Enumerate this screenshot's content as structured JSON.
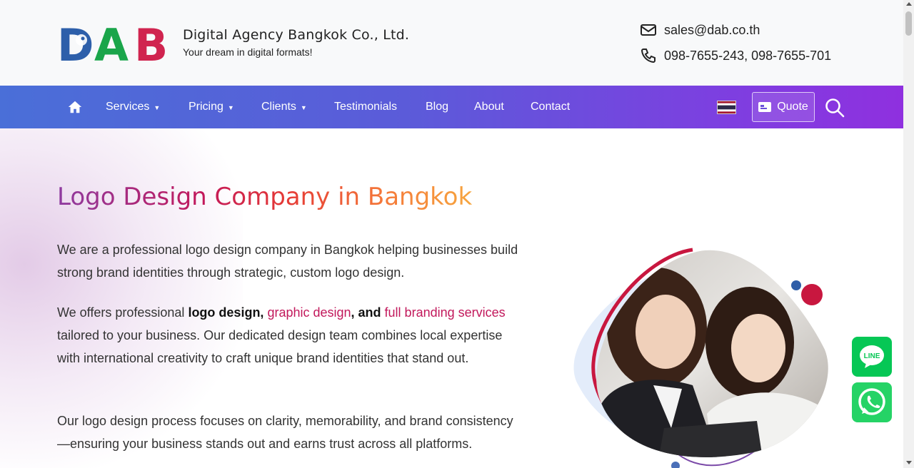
{
  "header": {
    "logo_text": "DAB",
    "company_name": "Digital Agency Bangkok Co., Ltd.",
    "tagline": "Your dream in digital formats!",
    "email": "sales@dab.co.th",
    "phones": "098-7655-243, 098-7655-701",
    "icons": {
      "email": "envelope-icon",
      "phone": "phone-icon"
    }
  },
  "nav": {
    "home_icon": "home-icon",
    "items": [
      {
        "label": "Services",
        "dropdown": true
      },
      {
        "label": "Pricing",
        "dropdown": true
      },
      {
        "label": "Clients",
        "dropdown": true
      },
      {
        "label": "Testimonials",
        "dropdown": false
      },
      {
        "label": "Blog",
        "dropdown": false
      },
      {
        "label": "About",
        "dropdown": false
      },
      {
        "label": "Contact",
        "dropdown": false
      }
    ],
    "caret": "▼",
    "language_flag": "thai-flag-icon",
    "quote_label": "Quote",
    "search_icon": "search-icon",
    "gradient": [
      "#4a6fd8",
      "#8f30df"
    ]
  },
  "hero": {
    "title": "Logo Design Company in Bangkok",
    "p1": "We are a professional logo design company in Bangkok helping businesses build strong brand identities through strategic, custom logo design.",
    "p2": {
      "prefix": "We offers professional ",
      "bold1": "logo design, ",
      "link1": "graphic design",
      "bold2": ", and ",
      "link2": "full branding services",
      "suffix": " tailored to your business. Our dedicated design team combines local expertise with international creativity to craft unique brand identities that stand out."
    },
    "p3": "Our logo design process focuses on clarity, memorability, and brand consistency—ensuring your business stands out and earns trust across all platforms."
  },
  "floating": {
    "line_label": "LINE",
    "line_icon": "line-icon",
    "whatsapp_icon": "whatsapp-icon"
  },
  "colors": {
    "accent_red": "#c2185b",
    "line_green": "#06c755",
    "whatsapp_green": "#25d366"
  }
}
